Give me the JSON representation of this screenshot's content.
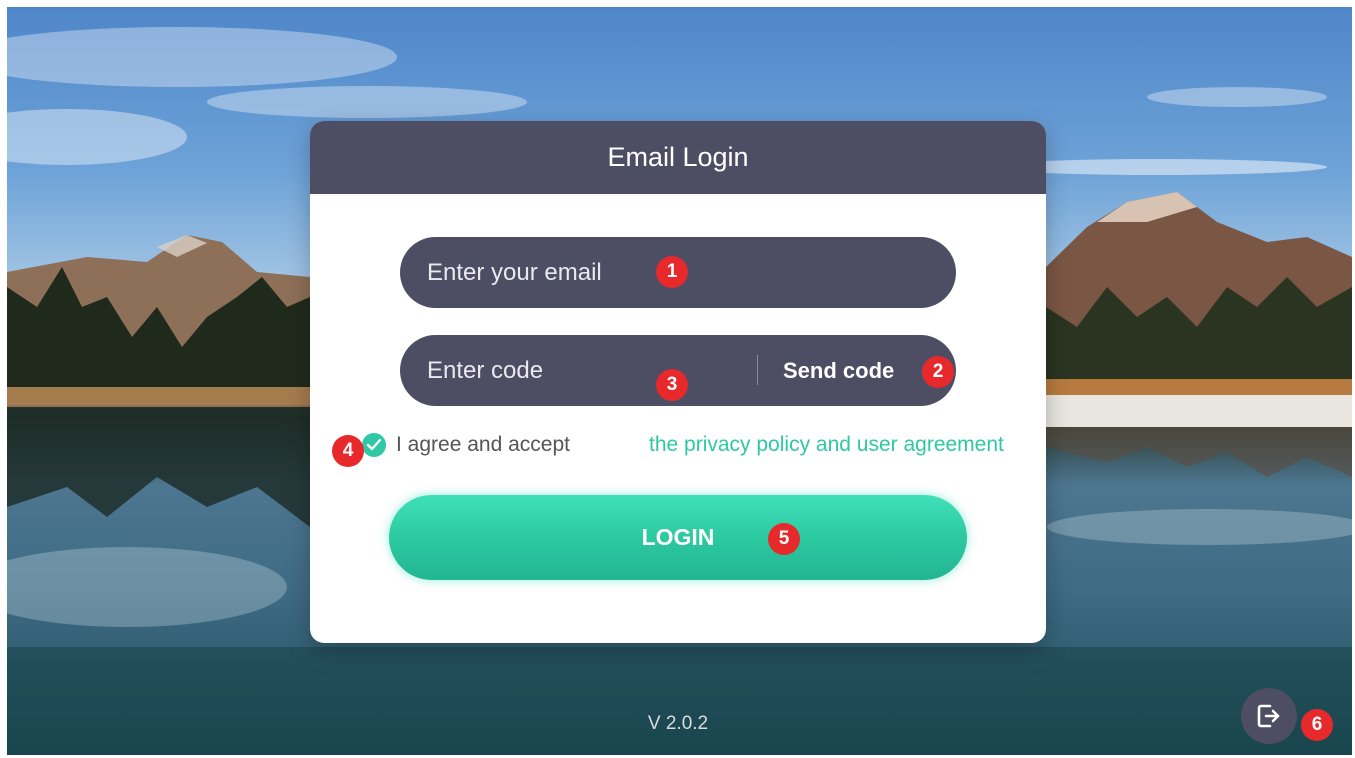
{
  "login": {
    "title": "Email Login",
    "email_placeholder": "Enter your email",
    "code_placeholder": "Enter code",
    "send_code_label": "Send code",
    "agree_text": "I agree and accept",
    "agree_link": "the privacy policy and user agreement",
    "agree_checked": true,
    "login_label": "LOGIN"
  },
  "version": "V 2.0.2",
  "annotations": [
    "1",
    "2",
    "3",
    "4",
    "5",
    "6"
  ],
  "icons": {
    "checkbox": "check-icon",
    "exit": "exit-icon"
  },
  "colors": {
    "header": "#4d4d63",
    "accent": "#2ec9a4",
    "badge": "#e8292c"
  }
}
